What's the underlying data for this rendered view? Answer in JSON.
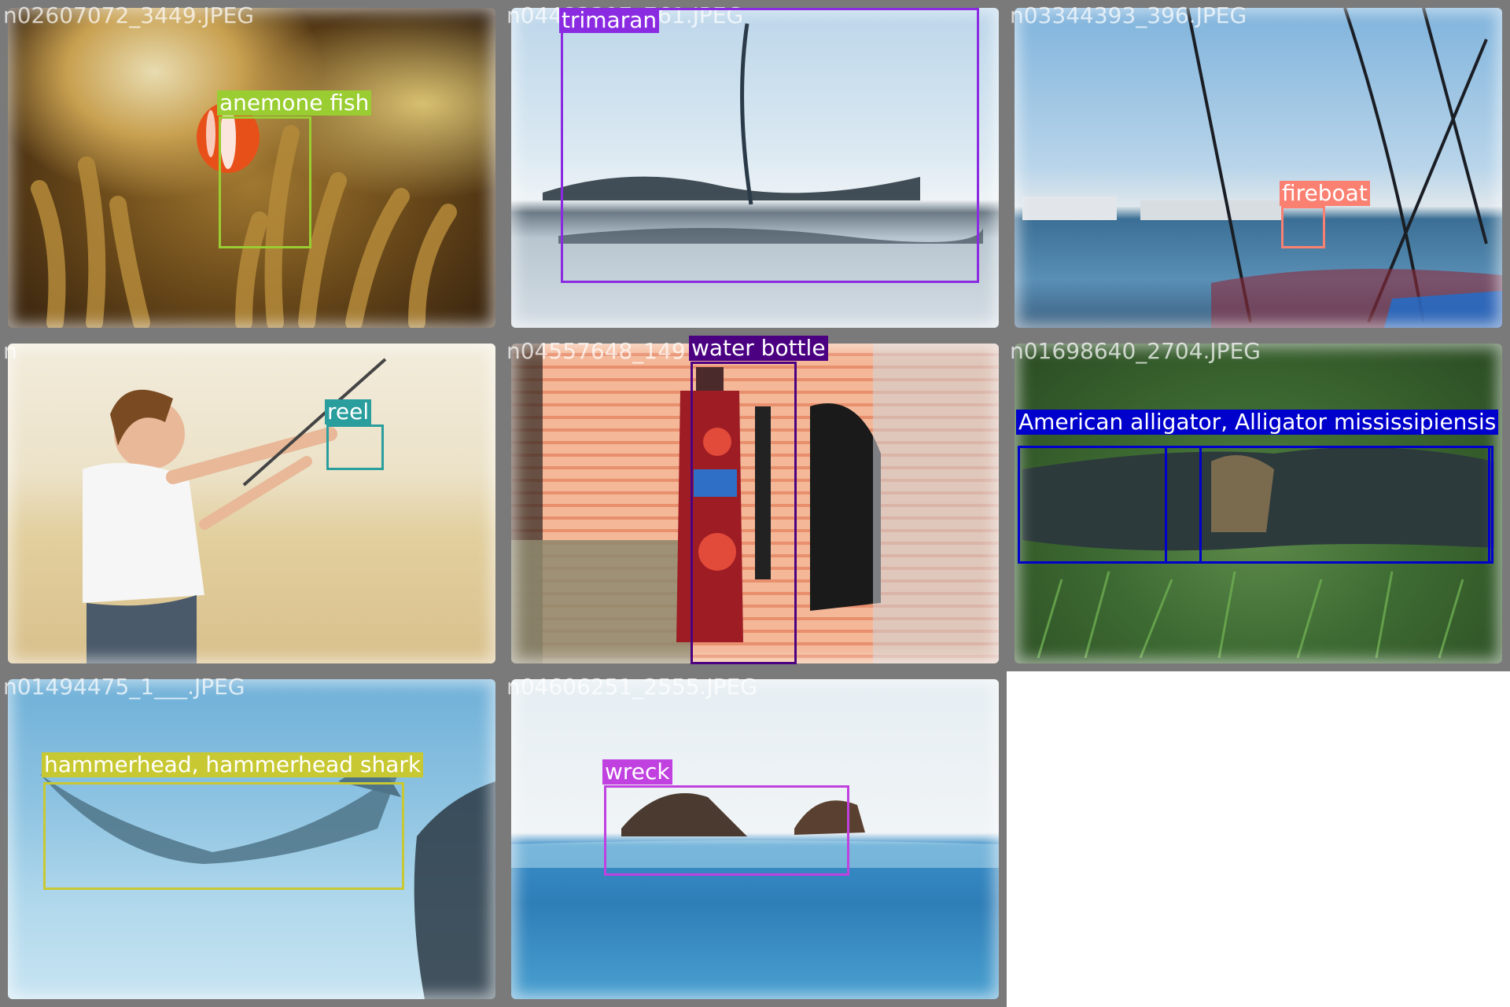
{
  "panels": [
    {
      "id": "p1",
      "filename": "n02607072_3449.JPEG",
      "labels": [
        {
          "text": "anemone fish",
          "color": "#9acd32"
        }
      ]
    },
    {
      "id": "p2",
      "filename": "n04483307_761.JPEG",
      "labels": [
        {
          "text": "trimaran",
          "color": "#8a2be2"
        }
      ]
    },
    {
      "id": "p3",
      "filename": "n03344393_396.JPEG",
      "labels": [
        {
          "text": "fireboat",
          "color": "#fa8072"
        }
      ]
    },
    {
      "id": "p4",
      "filename": "n",
      "labels": [
        {
          "text": "reel",
          "color": "#2a9d9d"
        }
      ]
    },
    {
      "id": "p5",
      "filename": "n04557648_149",
      "labels": [
        {
          "text": "water bottle",
          "color": "#4b0082"
        }
      ]
    },
    {
      "id": "p6",
      "filename": "n01698640_2704.JPEG",
      "labels": [
        {
          "text": "American alligator, Alligator mississipiensis",
          "color": "#0000cd"
        }
      ]
    },
    {
      "id": "p7",
      "filename": "n01494475_1___.JPEG",
      "labels": [
        {
          "text": "hammerhead, hammerhead shark",
          "color": "#c8c832"
        }
      ]
    },
    {
      "id": "p8",
      "filename": "n04606251_2555.JPEG",
      "labels": [
        {
          "text": "wreck",
          "color": "#c040e0"
        }
      ]
    }
  ]
}
